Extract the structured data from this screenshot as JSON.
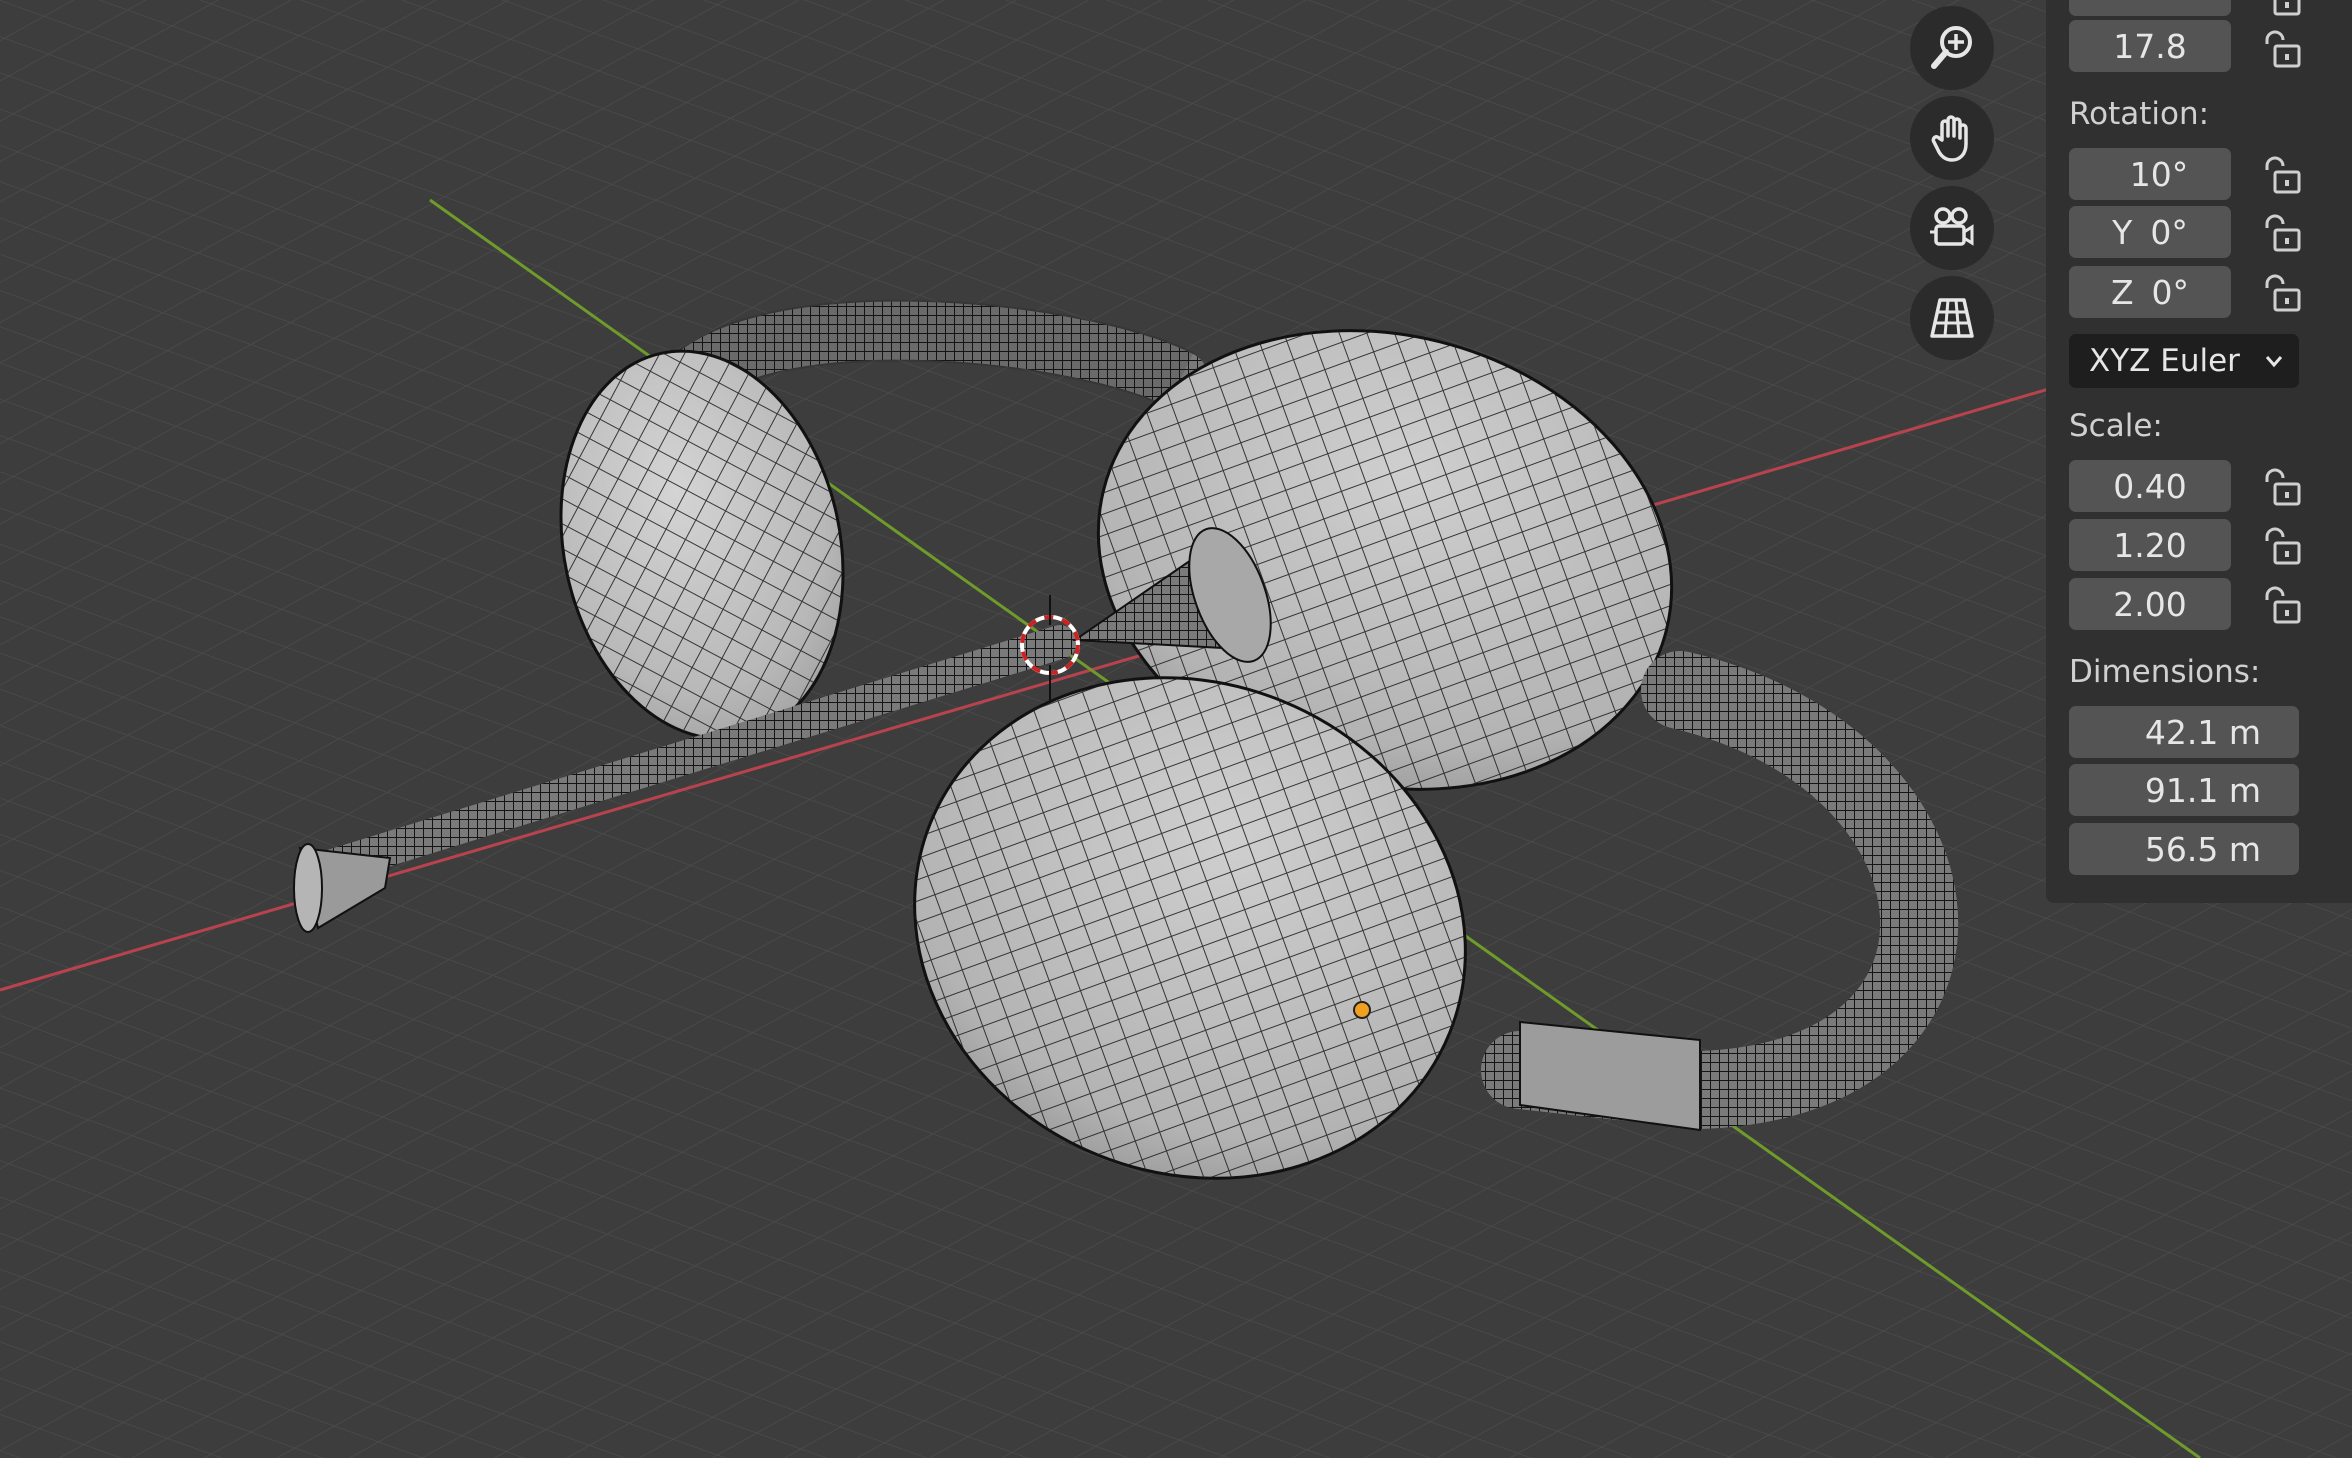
{
  "location": {
    "values": [
      "",
      "17.8"
    ]
  },
  "rotation": {
    "label": "Rotation:",
    "x": {
      "axis": "",
      "value": "10°"
    },
    "y": {
      "axis": "Y",
      "value": "0°"
    },
    "z": {
      "axis": "Z",
      "value": "0°"
    },
    "mode": "XYZ Euler"
  },
  "scale": {
    "label": "Scale:",
    "values": [
      "0.40",
      "1.20",
      "2.00"
    ]
  },
  "dimensions": {
    "label": "Dimensions:",
    "values": [
      "42.1 m",
      "91.1 m",
      "56.5 m"
    ]
  },
  "nav_gizmo": [
    "zoom-icon",
    "pan-hand-icon",
    "camera-view-icon",
    "perspective-grid-icon"
  ],
  "colors": {
    "viewport_bg": "#3d3d3d",
    "grid_line": "#4a4a4a",
    "x_axis": "#b8434f",
    "y_axis": "#6f9b2a",
    "panel_bg": "#303030",
    "field_bg": "#545454",
    "origin_dot": "#f0a020"
  }
}
